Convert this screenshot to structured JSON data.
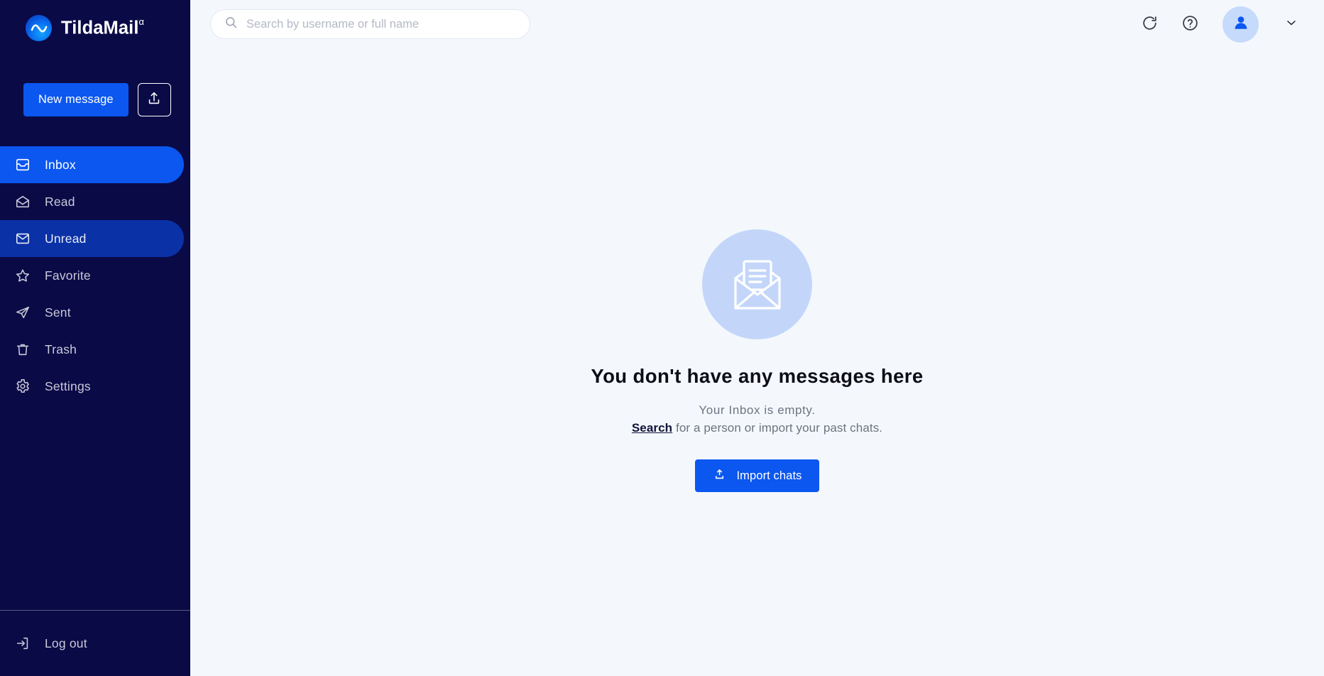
{
  "brand": {
    "name": "TildaMail",
    "superscript": "α",
    "logo_icon": "tilde-logo-icon"
  },
  "sidebar": {
    "new_message_label": "New message",
    "import_icon": "upload-icon",
    "items": [
      {
        "label": "Inbox",
        "icon": "inbox-icon",
        "state": "active-primary"
      },
      {
        "label": "Read",
        "icon": "mail-open-icon",
        "state": "default"
      },
      {
        "label": "Unread",
        "icon": "mail-closed-icon",
        "state": "active-secondary"
      },
      {
        "label": "Favorite",
        "icon": "star-icon",
        "state": "default"
      },
      {
        "label": "Sent",
        "icon": "send-icon",
        "state": "default"
      },
      {
        "label": "Trash",
        "icon": "trash-icon",
        "state": "default"
      },
      {
        "label": "Settings",
        "icon": "gear-icon",
        "state": "default"
      }
    ],
    "logout_label": "Log out",
    "logout_icon": "logout-icon"
  },
  "topbar": {
    "search_placeholder": "Search by username or full name",
    "search_value": "",
    "search_icon": "search-icon",
    "refresh_icon": "refresh-icon",
    "help_icon": "help-circle-icon",
    "avatar_icon": "user-avatar-icon",
    "chevron_icon": "chevron-down-icon"
  },
  "empty_state": {
    "illustration_icon": "envelope-letter-icon",
    "title": "You don't have any messages here",
    "subtitle_line1": "Your Inbox is empty.",
    "subtitle_link": "Search",
    "subtitle_line2": " for a person or import your past chats.",
    "import_button_label": "Import chats",
    "import_button_icon": "upload-icon"
  },
  "colors": {
    "sidebar_bg": "#0A0A47",
    "accent_blue": "#0B57F0",
    "active_secondary_blue": "#0A31A6",
    "main_bg": "#f4f8fc",
    "avatar_bg": "#C6DAFC",
    "illustration_bg": "#C3D6FA"
  }
}
